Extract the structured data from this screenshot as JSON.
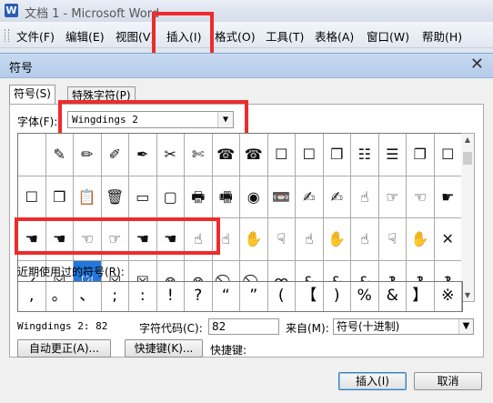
{
  "window": {
    "title": "文档 1 - Microsoft Word",
    "app_icon": "W"
  },
  "menubar": {
    "items": [
      "文件(F)",
      "编辑(E)",
      "视图(V)",
      "插入(I)",
      "格式(O)",
      "工具(T)",
      "表格(A)",
      "窗口(W)",
      "帮助(H)"
    ],
    "highlighted": "插入(I)"
  },
  "dialog": {
    "title": "符号",
    "close_glyph": "✕",
    "tabs": [
      "符号(S)",
      "特殊字符(P)"
    ],
    "font_label": "字体(F):",
    "font_value": "Wingdings 2",
    "symbols": [
      [
        "",
        "✎",
        "✏",
        "✐",
        "✒",
        "✂",
        "✄",
        "☎",
        "☎",
        "☐",
        "☐",
        "❐",
        "☷",
        "☰",
        "❐",
        "☐"
      ],
      [
        "☐",
        "❐",
        "📋",
        "🗑",
        "▭",
        "▢",
        "🖶",
        "🖷",
        "◉",
        "📼",
        "✍",
        "✍",
        "☝",
        "☞",
        "☜",
        "☛"
      ],
      [
        "☚",
        "☚",
        "☜",
        "☞",
        "☚",
        "☚",
        "☝",
        "☝",
        "✋",
        "☟",
        "☝",
        "✋",
        "☝",
        "☟",
        "✋",
        "✕"
      ],
      [
        "✓",
        "☒",
        "☑",
        "☒",
        "☒",
        "⊗",
        "⊗",
        "⃠",
        "⃠",
        "ꝏ",
        "&",
        "&",
        "&",
        "‽",
        "‽",
        "‽"
      ]
    ],
    "selected_symbol": "☑",
    "recent_label": "近期使用过的符号(R):",
    "recent_symbols": [
      ",",
      "。",
      "、",
      ";",
      ":",
      "!",
      "?",
      "“",
      "”",
      "(",
      "【",
      ")",
      "%",
      "&",
      "】",
      "※"
    ],
    "char_name": "Wingdings 2: 82",
    "code_label": "字符代码(C):",
    "code_value": "82",
    "from_label": "来自(M):",
    "from_value": "符号(十进制)",
    "autocorrect_button": "自动更正(A)...",
    "shortcut_button": "快捷键(K)...",
    "shortcut_text": "快捷键:",
    "insert_button": "插入(I)",
    "cancel_button": "取消"
  }
}
